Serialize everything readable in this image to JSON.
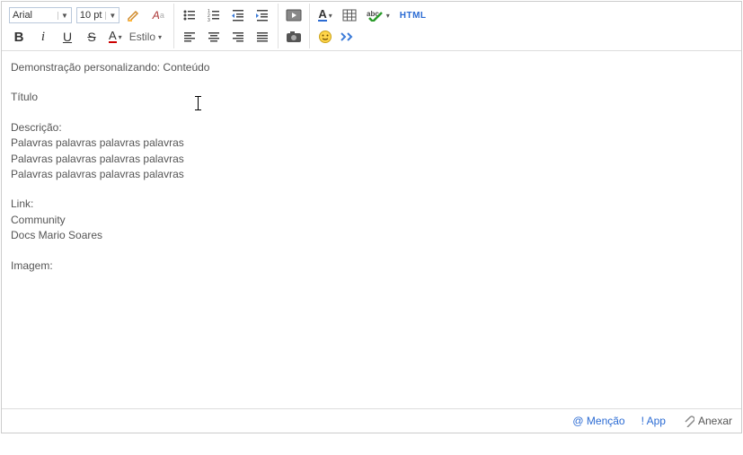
{
  "toolbar": {
    "font": "Arial",
    "size": "10 pt",
    "style_label": "Estilo",
    "html_label": "HTML"
  },
  "content": {
    "line1": "Demonstração personalizando: Conteúdo",
    "line2": "Título",
    "line3": "Descrição:",
    "line4": "Palavras palavras palavras palavras",
    "line5": "Palavras palavras palavras palavras",
    "line6": "Palavras palavras palavras palavras",
    "line7": "Link:",
    "line8": "Community",
    "line9": "Docs Mario Soares",
    "line10": "Imagem:"
  },
  "footer": {
    "mention": "@ Menção",
    "app": "! App",
    "attach": "Anexar"
  }
}
